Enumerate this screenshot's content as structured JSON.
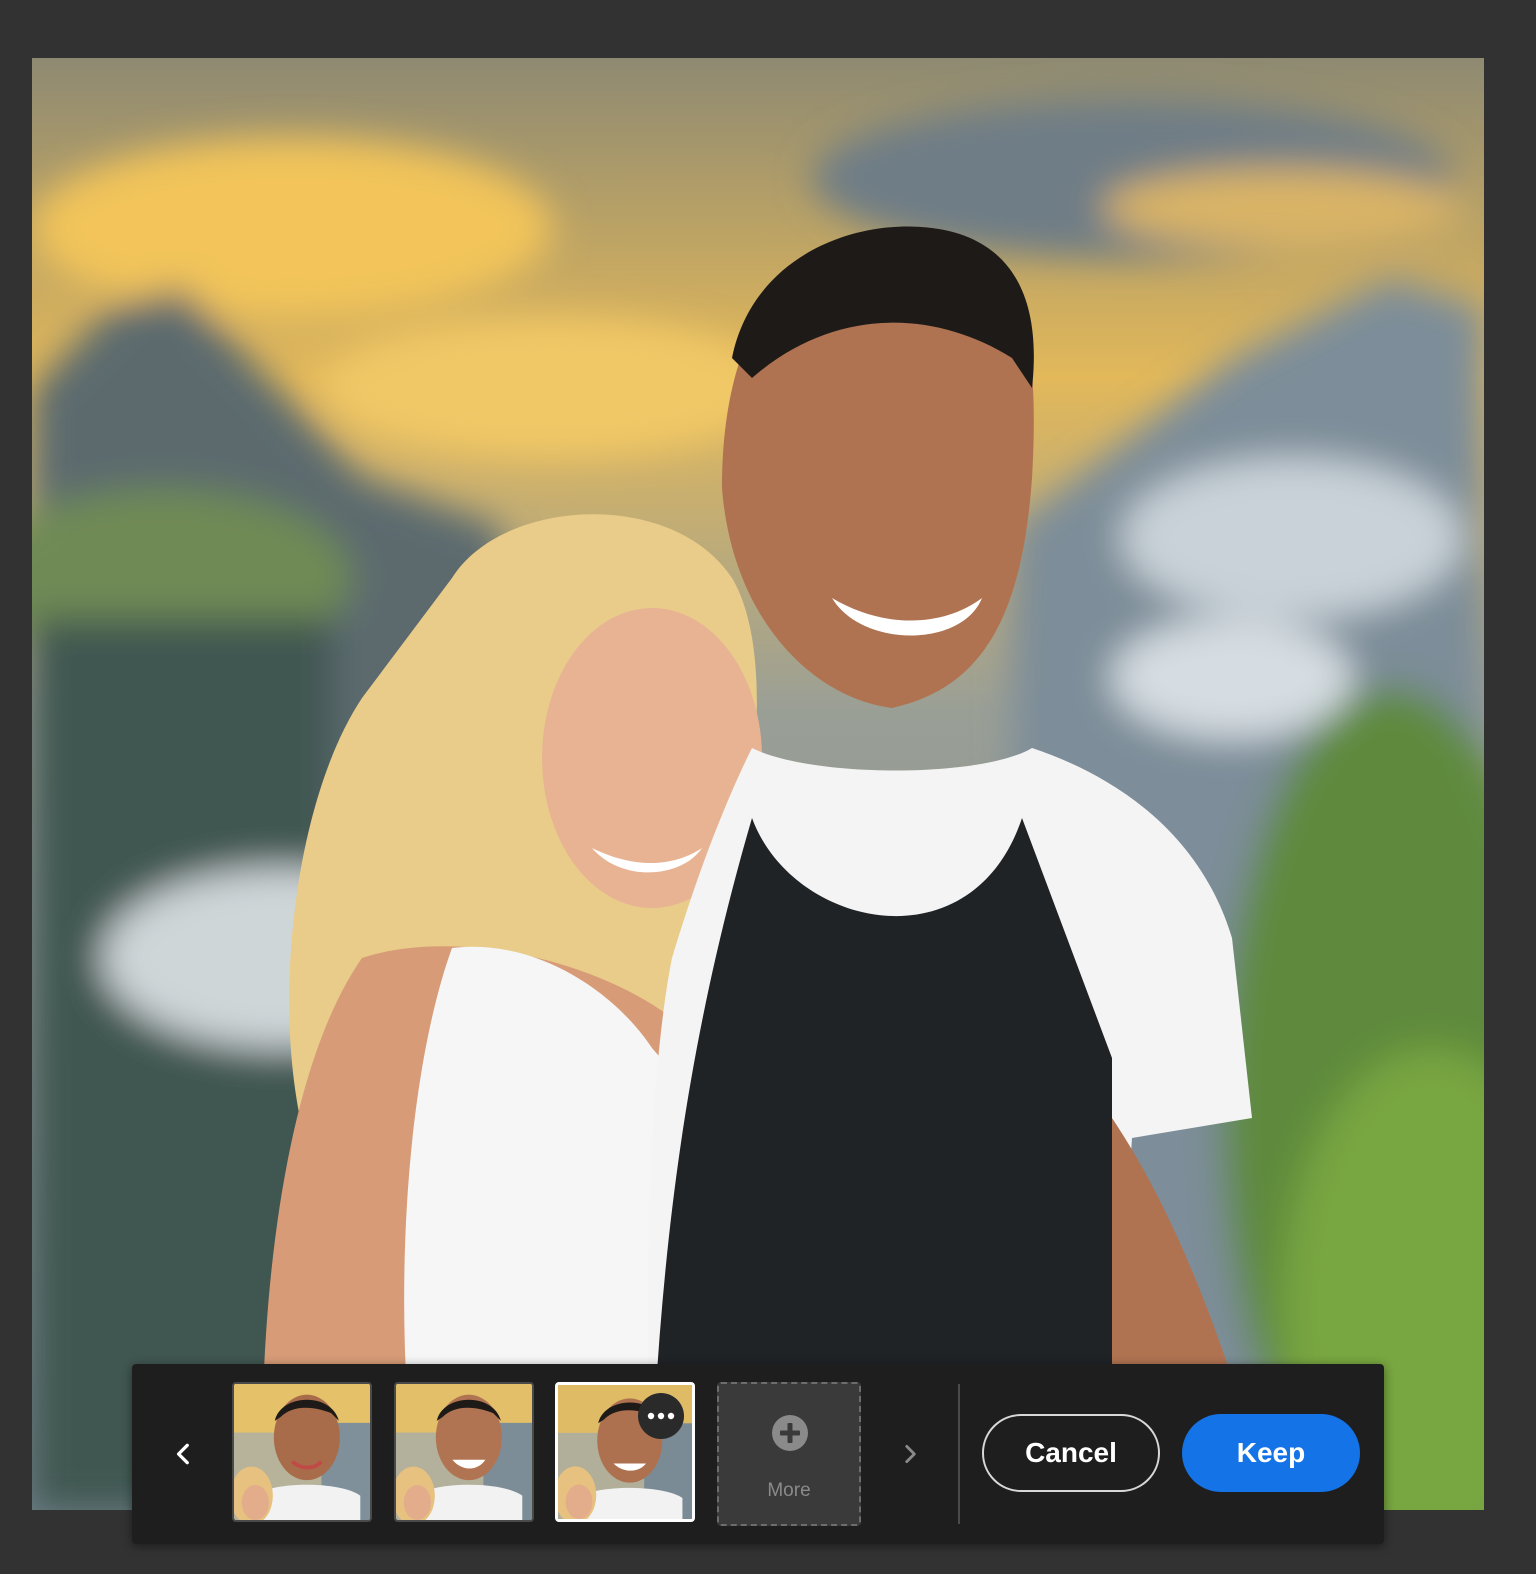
{
  "canvas": {
    "subject": "photo-couple-mountains"
  },
  "variations": {
    "prev_icon": "chevron-left-icon",
    "next_icon": "chevron-right-icon",
    "thumbnails": [
      {
        "index": 1,
        "selected": false
      },
      {
        "index": 2,
        "selected": false
      },
      {
        "index": 3,
        "selected": true,
        "menu_icon": "more-options-icon"
      }
    ],
    "more": {
      "icon": "plus-circle-icon",
      "label": "More"
    }
  },
  "actions": {
    "cancel_label": "Cancel",
    "keep_label": "Keep"
  },
  "colors": {
    "background": "#323232",
    "bar": "#1e1e1e",
    "accent": "#1473e6",
    "selected_border": "#ffffff"
  }
}
